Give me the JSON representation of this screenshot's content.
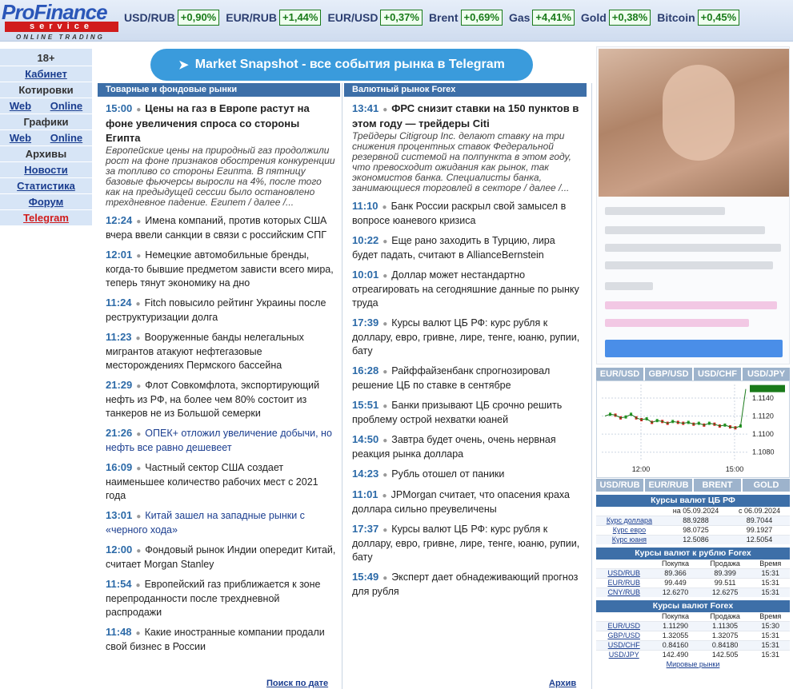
{
  "header": {
    "logo_main": "ProFinance",
    "logo_service": "service",
    "logo_tagline": "ONLINE TRADING",
    "quotes": [
      {
        "name": "USD/RUB",
        "change": "+0,90%"
      },
      {
        "name": "EUR/RUB",
        "change": "+1,44%"
      },
      {
        "name": "EUR/USD",
        "change": "+0,37%"
      },
      {
        "name": "Brent",
        "change": "+0,69%"
      },
      {
        "name": "Gas",
        "change": "+4,41%"
      },
      {
        "name": "Gold",
        "change": "+0,38%"
      },
      {
        "name": "Bitcoin",
        "change": "+0,45%"
      }
    ]
  },
  "nav": {
    "age": "18+",
    "cabinet": "Кабинет",
    "quotes_label": "Котировки",
    "quotes_web": "Web",
    "quotes_online": "Online",
    "charts_label": "Графики",
    "charts_web": "Web",
    "charts_online": "Online",
    "archives": "Архивы",
    "news": "Новости",
    "statistics": "Статистика",
    "forum": "Форум",
    "telegram": "Telegram"
  },
  "banner": {
    "text": "Market Snapshot - все события рынка в Telegram"
  },
  "commodities": {
    "heading": "Товарные и фондовые рынки",
    "lead": {
      "time": "15:00",
      "title": "Цены на газ в Европе растут на фоне увеличения спроса со стороны Египта",
      "desc": "Европейские цены на природный газ продолжили рост на фоне признаков обострения конкуренции за топливо со стороны Египта. В пятницу базовые фьючерсы выросли на 4%, после того как на предыдущей сессии было остановлено трехдневное падение. Египет  / далее /..."
    },
    "items": [
      {
        "time": "12:24",
        "title": "Имена компаний, против которых США вчера ввели санкции в связи с российским СПГ"
      },
      {
        "time": "12:01",
        "title": "Немецкие автомобильные бренды, когда-то бывшие предметом зависти всего мира, теперь тянут экономику на дно"
      },
      {
        "time": "11:24",
        "title": "Fitch повысило рейтинг Украины после реструктуризации долга"
      },
      {
        "time": "11:23",
        "title": "Вооруженные банды нелегальных мигрантов атакуют нефтегазовые месторождениях Пермского бассейна"
      },
      {
        "time": "21:29",
        "title": "Флот Совкомфлота, экспортирующий нефть из РФ, на более чем 80% состоит из танкеров не из Большой семерки"
      },
      {
        "time": "21:26",
        "title": "ОПЕК+ отложил увеличение добычи, но нефть все равно дешевеет"
      },
      {
        "time": "16:09",
        "title": "Частный сектор США создает наименьшее количество рабочих мест с 2021 года"
      },
      {
        "time": "13:01",
        "title": "Китай зашел на западные рынки с «черного хода»"
      },
      {
        "time": "12:00",
        "title": "Фондовый рынок Индии опередит Китай, считает Morgan Stanley"
      },
      {
        "time": "11:54",
        "title": "Европейский газ приближается к зоне перепроданности после трехдневной распродажи"
      },
      {
        "time": "11:48",
        "title": "Какие иностранные компании продали свой бизнес в России"
      }
    ],
    "footer": "Поиск по дате"
  },
  "forex": {
    "heading": "Валютный рынок Forex",
    "lead": {
      "time": "13:41",
      "title": "ФРС снизит ставки на 150 пунктов в этом году — трейдеры Citi",
      "desc": "Трейдеры Citigroup Inc. делают ставку на три снижения процентных ставок Федеральной резервной системой на полпункта в этом году, что превосходит ожидания как рынок, так экономистов банка. Специалисты банка, занимающиеся торговлей в секторе  / далее /..."
    },
    "items": [
      {
        "time": "11:10",
        "title": "Банк России раскрыл свой замысел в вопросе юаневого кризиса"
      },
      {
        "time": "10:22",
        "title": "Еще рано заходить в Турцию, лира будет падать, считают в AllianceBernstein"
      },
      {
        "time": "10:01",
        "title": "Доллар может нестандартно отреагировать на сегодняшние данные по рынку труда"
      },
      {
        "time": "17:39",
        "title": "Курсы валют ЦБ РФ: курс рубля к доллару, евро, гривне, лире, тенге, юаню, рупии, бату"
      },
      {
        "time": "16:28",
        "title": "Райффайзенбанк спрогнозировал решение ЦБ по ставке в сентябре"
      },
      {
        "time": "15:51",
        "title": "Банки призывают ЦБ срочно решить проблему острой нехватки юаней"
      },
      {
        "time": "14:50",
        "title": "Завтра будет очень, очень нервная реакция рынка доллара"
      },
      {
        "time": "14:23",
        "title": "Рубль отошел от паники"
      },
      {
        "time": "11:01",
        "title": "JPMorgan считает, что опасения краха доллара сильно преувеличены"
      },
      {
        "time": "17:37",
        "title": "Курсы валют ЦБ РФ: курс рубля к доллару, евро, гривне, лире, тенге, юаню, рупии, бату"
      },
      {
        "time": "15:49",
        "title": "Эксперт дает обнадеживающий прогноз для рубля"
      }
    ],
    "footer": "Архив"
  },
  "widget": {
    "ccy_tabs": [
      "EUR/USD",
      "GBP/USD",
      "USD/CHF",
      "USD/JPY"
    ],
    "rate_tabs": [
      "USD/RUB",
      "EUR/RUB",
      "BRENT",
      "GOLD"
    ]
  },
  "chart_data": {
    "type": "line",
    "title": "",
    "x_ticks": [
      "12:00",
      "15:00"
    ],
    "y_ticks": [
      "1.1140",
      "1.1120",
      "1.1100",
      "1.1080"
    ],
    "ylim": [
      1.107,
      1.1155
    ],
    "series": [
      {
        "values": [
          1.112,
          1.1122,
          1.1121,
          1.1118,
          1.1119,
          1.1122,
          1.1118,
          1.1116,
          1.1117,
          1.1113,
          1.1115,
          1.1114,
          1.1112,
          1.1114,
          1.1113,
          1.1112,
          1.1113,
          1.1111,
          1.1112,
          1.111,
          1.1112,
          1.1111,
          1.1109,
          1.111,
          1.1108,
          1.1107,
          1.1109,
          1.115
        ]
      }
    ],
    "colors": {
      "up": "#2a9d2a",
      "down": "#d11c1c",
      "line": "#1a7a1a"
    }
  },
  "cbr_table": {
    "title": "Курсы валют ЦБ РФ",
    "col_date1": "на 05.09.2024",
    "col_date2": "с 06.09.2024",
    "rows": [
      {
        "name": "Курс доллара",
        "v1": "88.9288",
        "v2": "89.7044"
      },
      {
        "name": "Курс евро",
        "v1": "98.0725",
        "v2": "99.1927"
      },
      {
        "name": "Курс юаня",
        "v1": "12.5086",
        "v2": "12.5054"
      }
    ]
  },
  "rub_forex_table": {
    "title": "Курсы валют к рублю Forex",
    "head_buy": "Покупка",
    "head_sell": "Продажа",
    "head_time": "Время",
    "rows": [
      {
        "pair": "USD/RUB",
        "buy": "89.366",
        "sell": "89.399",
        "time": "15:31"
      },
      {
        "pair": "EUR/RUB",
        "buy": "99.449",
        "sell": "99.511",
        "time": "15:31"
      },
      {
        "pair": "CNY/RUB",
        "buy": "12.6270",
        "sell": "12.6275",
        "time": "15:31"
      }
    ]
  },
  "forex_table": {
    "title": "Курсы валют Forex",
    "head_buy": "Покупка",
    "head_sell": "Продажа",
    "head_time": "Время",
    "rows": [
      {
        "pair": "EUR/USD",
        "buy": "1.11290",
        "sell": "1.11305",
        "time": "15:30"
      },
      {
        "pair": "GBP/USD",
        "buy": "1.32055",
        "sell": "1.32075",
        "time": "15:31"
      },
      {
        "pair": "USD/CHF",
        "buy": "0.84160",
        "sell": "0.84180",
        "time": "15:31"
      },
      {
        "pair": "USD/JPY",
        "buy": "142.490",
        "sell": "142.505",
        "time": "15:31"
      }
    ],
    "mirror_link": "Мировые рынки"
  }
}
